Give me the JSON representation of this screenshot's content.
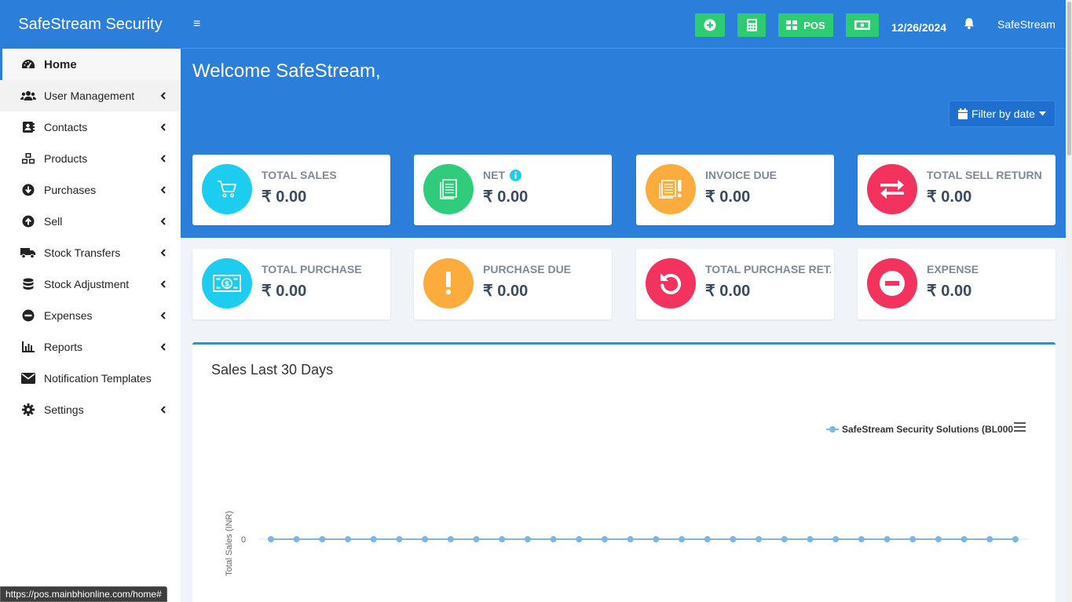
{
  "sidebar": {
    "brand": "SafeStream Security",
    "items": [
      {
        "label": "Home",
        "icon": "dashboard-icon",
        "has_children": false
      },
      {
        "label": "User Management",
        "icon": "users-icon",
        "has_children": true
      },
      {
        "label": "Contacts",
        "icon": "address-book-icon",
        "has_children": true
      },
      {
        "label": "Products",
        "icon": "cubes-icon",
        "has_children": true
      },
      {
        "label": "Purchases",
        "icon": "arrow-circle-down-icon",
        "has_children": true
      },
      {
        "label": "Sell",
        "icon": "arrow-circle-up-icon",
        "has_children": true
      },
      {
        "label": "Stock Transfers",
        "icon": "truck-icon",
        "has_children": true
      },
      {
        "label": "Stock Adjustment",
        "icon": "database-icon",
        "has_children": true
      },
      {
        "label": "Expenses",
        "icon": "minus-circle-icon",
        "has_children": true
      },
      {
        "label": "Reports",
        "icon": "bar-chart-icon",
        "has_children": true
      },
      {
        "label": "Notification Templates",
        "icon": "envelope-icon",
        "has_children": false
      },
      {
        "label": "Settings",
        "icon": "cog-icon",
        "has_children": true
      }
    ]
  },
  "topbar": {
    "menu_icon": "≡",
    "pos_label": "POS",
    "date": "12/26/2024",
    "username": "SafeStream"
  },
  "header": {
    "welcome": "Welcome SafeStream,",
    "filter_label": "Filter by date"
  },
  "stats": [
    {
      "label": "TOTAL SALES",
      "value": "₹ 0.00",
      "icon": "cart-icon",
      "color": "#1ccdf0"
    },
    {
      "label": "NET",
      "value": "₹ 0.00",
      "icon": "ledger-icon",
      "color": "#2fcc7b",
      "info": true
    },
    {
      "label": "INVOICE DUE",
      "value": "₹ 0.00",
      "icon": "invoice-alert-icon",
      "color": "#fbac3d"
    },
    {
      "label": "TOTAL SELL RETURN",
      "value": "₹ 0.00",
      "icon": "exchange-icon",
      "color": "#f3325e"
    },
    {
      "label": "TOTAL PURCHASE",
      "value": "₹ 0.00",
      "icon": "money-bill-icon",
      "color": "#1ccdf0"
    },
    {
      "label": "PURCHASE DUE",
      "value": "₹ 0.00",
      "icon": "exclamation-icon",
      "color": "#fbac3d"
    },
    {
      "label": "TOTAL PURCHASE RET...",
      "value": "₹ 0.00",
      "icon": "undo-icon",
      "color": "#f3325e"
    },
    {
      "label": "EXPENSE",
      "value": "₹ 0.00",
      "icon": "minus-circle-icon",
      "color": "#f3325e"
    }
  ],
  "chart_panel": {
    "title": "Sales Last 30 Days"
  },
  "chart_data": {
    "type": "line",
    "title": "",
    "xlabel": "",
    "ylabel": "Total Sales (INR)",
    "y_ticks": [
      "0"
    ],
    "series": [
      {
        "name": "SafeStream Security Solutions (BL000",
        "values": [
          0,
          0,
          0,
          0,
          0,
          0,
          0,
          0,
          0,
          0,
          0,
          0,
          0,
          0,
          0,
          0,
          0,
          0,
          0,
          0,
          0,
          0,
          0,
          0,
          0,
          0,
          0,
          0,
          0,
          0
        ]
      }
    ],
    "legend_position": "top-right",
    "color": "#7cb5ec"
  },
  "status_url": "https://pos.mainbhionline.com/home#"
}
